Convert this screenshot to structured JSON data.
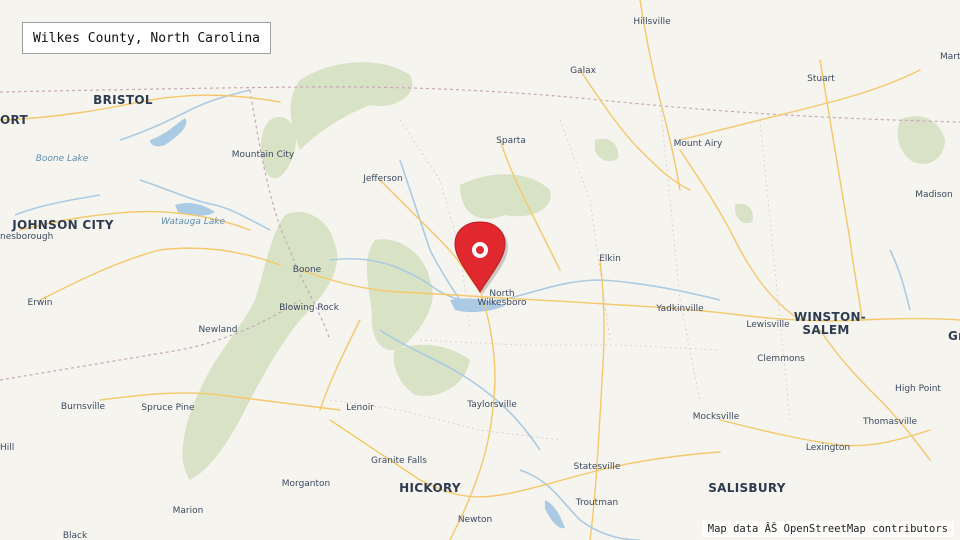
{
  "title": "Wilkes County, North Carolina",
  "attribution": "Map data ÂŠ OpenStreetMap contributors",
  "marker": {
    "label_line1": "North",
    "label_line2": "Wilkesboro",
    "icon": "map-pin-icon",
    "color": "#e0282e"
  },
  "places": {
    "bristol": "BRISTOL",
    "johnson_city": "JOHNSON CITY",
    "hickory": "HICKORY",
    "winston_l1": "WINSTON-",
    "winston_l2": "SALEM",
    "salisbury": "SALISBURY",
    "ort": "ORT",
    "gr": "Gr",
    "hillsville": "Hillsville",
    "galax": "Galax",
    "stuart": "Stuart",
    "mart": "Mart",
    "sparta": "Sparta",
    "mount_airy": "Mount Airy",
    "mountain_city": "Mountain City",
    "jefferson": "Jefferson",
    "madison": "Madison",
    "jonesborough": "nesborough",
    "boone": "Boone",
    "elkin": "Elkin",
    "erwin": "Erwin",
    "blowing_rock": "Blowing Rock",
    "yadkinville": "Yadkinville",
    "lewisville": "Lewisville",
    "newland": "Newland",
    "clemmons": "Clemmons",
    "high_point": "High Point",
    "burnsville": "Burnsville",
    "spruce_pine": "Spruce Pine",
    "lenoir": "Lenoir",
    "taylorsville": "Taylorsville",
    "mocksville": "Mocksville",
    "thomasville": "Thomasville",
    "hill": "Hill",
    "granite_falls": "Granite Falls",
    "lexington": "Lexington",
    "morganton": "Morganton",
    "statesville": "Statesville",
    "troutman": "Troutman",
    "marion": "Marion",
    "newton": "Newton",
    "black": "Black"
  },
  "water": {
    "boone_lake": "Boone Lake",
    "watauga_lake": "Watauga Lake"
  },
  "colors": {
    "background": "#f6f4ee",
    "forest": "#cfdcb8",
    "water": "#aacbe3",
    "road": "#f4c86a",
    "border": "#c9a8b8"
  }
}
